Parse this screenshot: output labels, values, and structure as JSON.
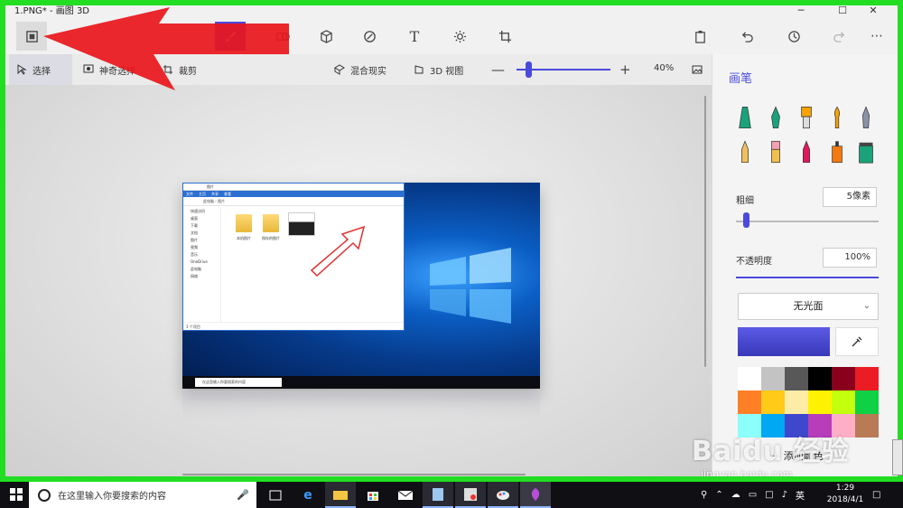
{
  "window": {
    "title": "1.PNG* - 画图 3D",
    "controls": {
      "minimize": "─",
      "maximize": "☐",
      "close": "✕"
    }
  },
  "toolbar": {
    "items": [
      {
        "name": "menu",
        "icon": "menu-icon",
        "active": false
      },
      {
        "name": "brushes",
        "icon": "brush-icon",
        "active": true
      },
      {
        "name": "2d-shapes",
        "icon": "2d-shapes-icon",
        "active": false
      },
      {
        "name": "3d-shapes",
        "icon": "cube-icon",
        "active": false
      },
      {
        "name": "stickers",
        "icon": "sticker-icon",
        "active": false
      },
      {
        "name": "text",
        "icon": "text-icon",
        "active": false,
        "glyph": "T"
      },
      {
        "name": "effects",
        "icon": "sun-icon",
        "active": false
      },
      {
        "name": "canvas",
        "icon": "crop-icon",
        "active": false
      }
    ],
    "right": [
      "paste-icon",
      "undo-icon",
      "history-icon",
      "redo-icon",
      "more-icon"
    ],
    "more_glyph": "⋯"
  },
  "subbar": {
    "select": "选择",
    "magic_select": "神奇选择",
    "crop": "裁剪",
    "mixed_reality": "混合现实",
    "view_3d": "3D 视图",
    "zoom_minus": "—",
    "zoom_plus": "+",
    "zoom_value": "40%",
    "zoom_level": 0.1
  },
  "explorer": {
    "title": "图片",
    "ribbon": [
      "文件",
      "主页",
      "共享",
      "查看"
    ],
    "address": "此电脑 › 图片",
    "nav": [
      "快速访问",
      "桌面",
      "下载",
      "文档",
      "图片",
      "视频",
      "音乐",
      "OneDrive",
      "此电脑",
      "网络"
    ],
    "folders": [
      "本机照片",
      "保存的图片"
    ],
    "status": "3 个项目",
    "taskbar_search": "在这里输入你要搜索的内容"
  },
  "panel": {
    "title": "画笔",
    "brushes": [
      "marker",
      "calligraphy-pen",
      "oil-brush",
      "watercolor",
      "pixel-pen",
      "pencil",
      "eraser",
      "crayon",
      "spray-can",
      "fill"
    ],
    "thickness_label": "粗细",
    "thickness_value": "5像素",
    "thickness_level": 0.05,
    "opacity_label": "不透明度",
    "opacity_value": "100%",
    "opacity_level": 1.0,
    "material": "无光面",
    "current_color": "#4a4adc",
    "palette": [
      "#ffffff",
      "#c3c3c3",
      "#585858",
      "#000000",
      "#88001b",
      "#ec1c24",
      "#ff7f27",
      "#ffca18",
      "#fdeca6",
      "#fff200",
      "#c4ff0e",
      "#0ed145",
      "#8cfffb",
      "#00a8f3",
      "#3f48cc",
      "#b83dba",
      "#ffaec8",
      "#b97a56"
    ],
    "add_color": "+ 添加颜色"
  },
  "taskbar": {
    "search_placeholder": "在这里输入你要搜索的内容",
    "apps": [
      "task-view-icon",
      "edge-icon",
      "file-explorer-icon",
      "store-icon",
      "mail-icon",
      "notepad-icon",
      "snipping-icon",
      "paint-icon",
      "paint3d-icon"
    ],
    "ime": "英",
    "time": "1:29",
    "date": "2018/4/1"
  },
  "watermark": {
    "brand": "Baidu 经验",
    "url": "jingyan.baidu.com"
  }
}
